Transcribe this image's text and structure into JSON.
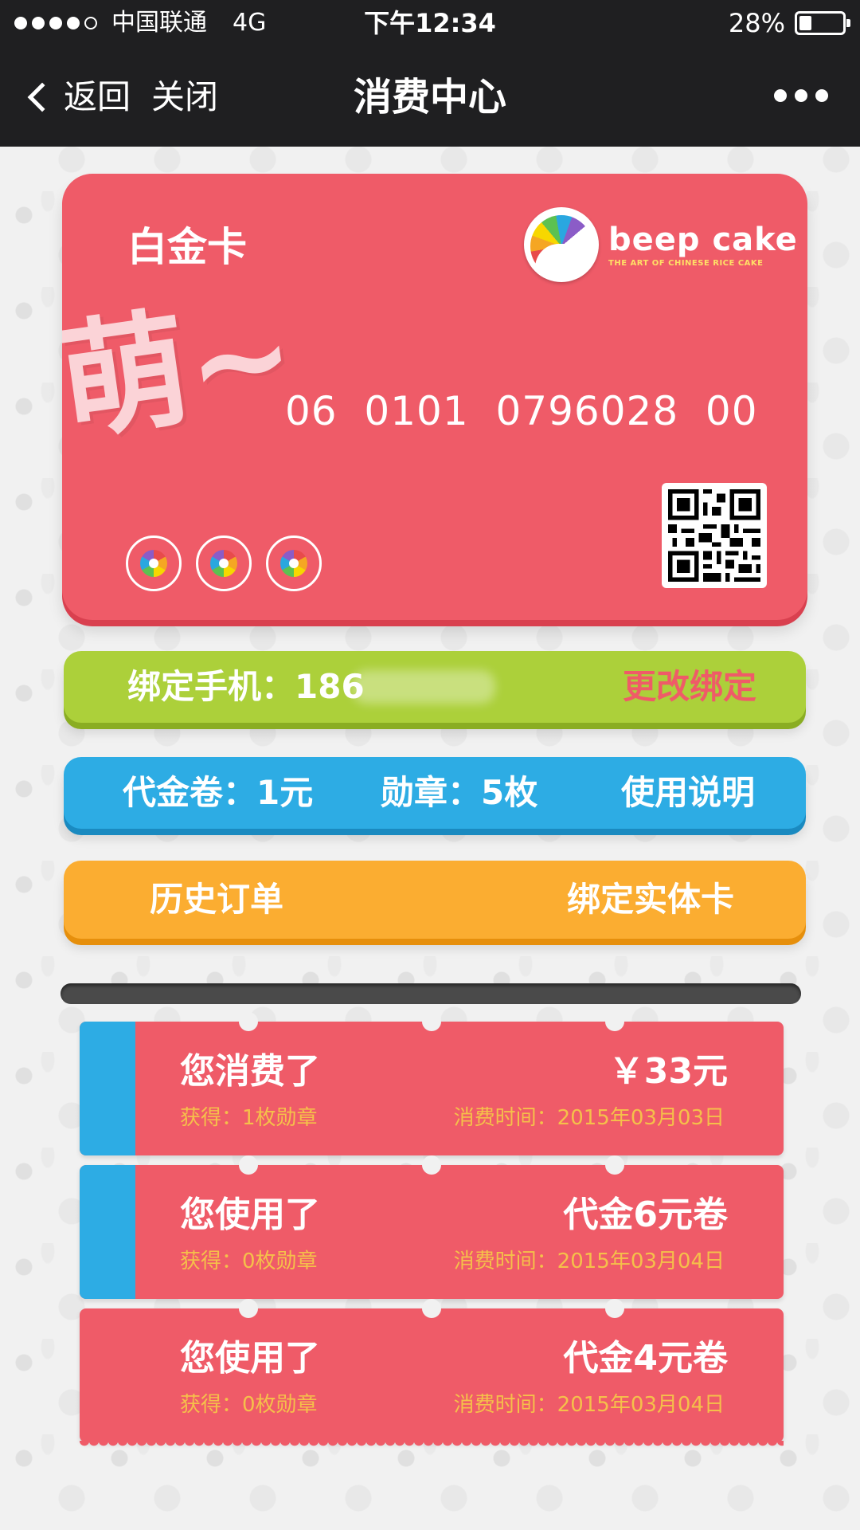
{
  "status_bar": {
    "carrier": "中国联通",
    "network": "4G",
    "time": "下午12:34",
    "battery_percent": "28%",
    "battery_level": 0.28
  },
  "nav": {
    "back_label": "返回",
    "close_label": "关闭",
    "title": "消费中心"
  },
  "card": {
    "type_label": "白金卡",
    "moe_text": "萌~",
    "number": "06  0101  0796028  00",
    "logo_name": "beep cake",
    "logo_tagline": "THE ART OF CHINESE RICE CAKE"
  },
  "phone_bar": {
    "label": "绑定手机：186",
    "action": "更改绑定"
  },
  "info_bar": {
    "voucher": "代金卷：1元",
    "medals": "勋章：5枚",
    "usage": "使用说明"
  },
  "order_bar": {
    "history": "历史订单",
    "bind_card": "绑定实体卡"
  },
  "tickets": [
    {
      "title": "您消费了",
      "amount": "￥33元",
      "gain": "获得：1枚勋章",
      "time": "消费时间：2015年03月03日"
    },
    {
      "title": "您使用了",
      "amount": "代金6元卷",
      "gain": "获得：0枚勋章",
      "time": "消费时间：2015年03月04日"
    },
    {
      "title": "您使用了",
      "amount": "代金4元卷",
      "gain": "获得：0枚勋章",
      "time": "消费时间：2015年03月04日"
    }
  ],
  "colors": {
    "card": "#ef5b68",
    "green": "#acd03a",
    "blue": "#2dace4",
    "orange": "#fbad31",
    "nav": "#1f1f21"
  },
  "icons": [
    "signal-icon",
    "battery-icon",
    "back-chevron-icon",
    "more-icon",
    "beep-cake-logo",
    "qr-code-icon",
    "badge-icon"
  ]
}
